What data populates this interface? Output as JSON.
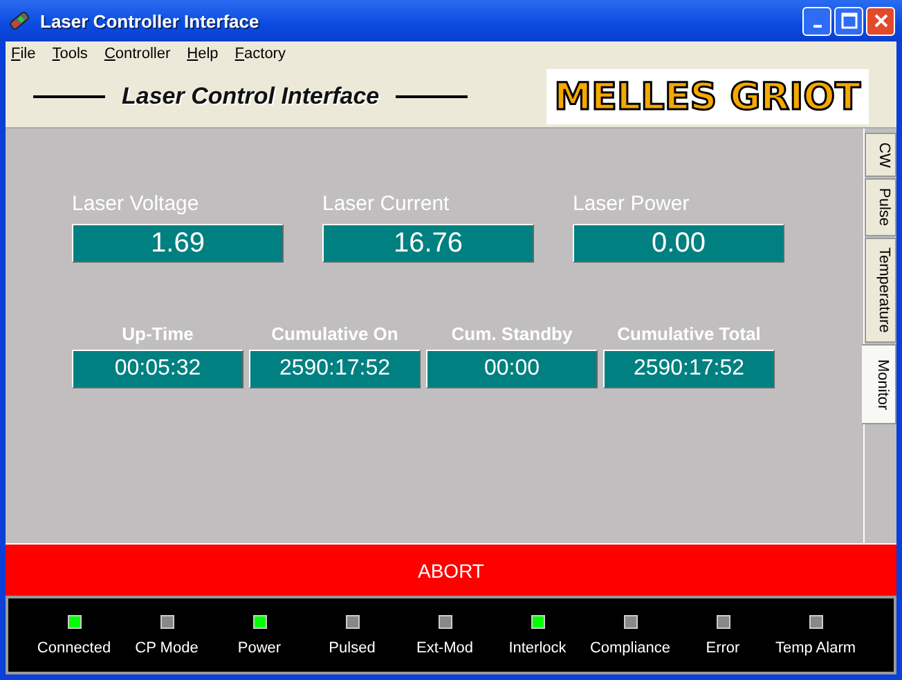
{
  "window": {
    "title": "Laser Controller Interface"
  },
  "menu": [
    {
      "label": "File"
    },
    {
      "label": "Tools"
    },
    {
      "label": "Controller"
    },
    {
      "label": "Help"
    },
    {
      "label": "Factory"
    }
  ],
  "banner": {
    "title": "Laser Control Interface",
    "logo": "MELLES GRIOT"
  },
  "readings": [
    {
      "label": "Laser Voltage",
      "value": "1.69"
    },
    {
      "label": "Laser Current",
      "value": "16.76"
    },
    {
      "label": "Laser Power",
      "value": "0.00"
    }
  ],
  "timers": [
    {
      "label": "Up-Time",
      "value": "00:05:32"
    },
    {
      "label": "Cumulative On",
      "value": "2590:17:52"
    },
    {
      "label": "Cum. Standby",
      "value": "00:00"
    },
    {
      "label": "Cumulative Total",
      "value": "2590:17:52"
    }
  ],
  "tabs": [
    {
      "label": "CW",
      "selected": false
    },
    {
      "label": "Pulse",
      "selected": false
    },
    {
      "label": "Temperature",
      "selected": false
    },
    {
      "label": "Monitor",
      "selected": true
    }
  ],
  "abort_button": "ABORT",
  "indicators": [
    {
      "label": "Connected",
      "on": true
    },
    {
      "label": "CP Mode",
      "on": false
    },
    {
      "label": "Power",
      "on": true
    },
    {
      "label": "Pulsed",
      "on": false
    },
    {
      "label": "Ext-Mod",
      "on": false
    },
    {
      "label": "Interlock",
      "on": true
    },
    {
      "label": "Compliance",
      "on": false
    },
    {
      "label": "Error",
      "on": false
    },
    {
      "label": "Temp Alarm",
      "on": false
    }
  ]
}
